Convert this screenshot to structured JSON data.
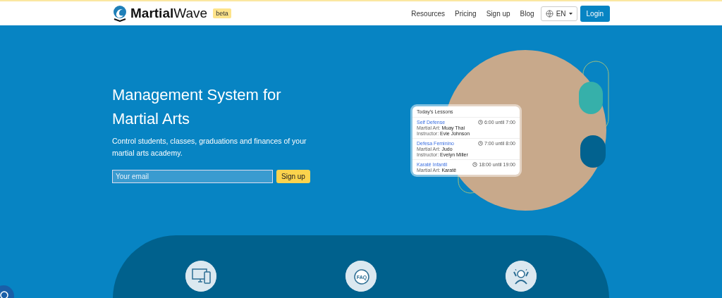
{
  "header": {
    "logo": {
      "bold": "Martial",
      "light": "Wave"
    },
    "badge": "beta",
    "nav": [
      "Resources",
      "Pricing",
      "Sign up",
      "Blog"
    ],
    "language": "EN",
    "login": "Login"
  },
  "hero": {
    "title": "Management System for Martial Arts",
    "subtitle": "Control students, classes, graduations and finances of your martial arts academy.",
    "email": {
      "placeholder": "Your email"
    },
    "signup": "Sign up"
  },
  "lessons_card": {
    "title": "Today's Lessons",
    "lessons": [
      {
        "name": "Self Defense",
        "time": "6:00 until 7:00",
        "details": [
          {
            "label": "Martial Art:",
            "value": "Muay Thai"
          },
          {
            "label": "Instructor:",
            "value": "Evie Johnson"
          }
        ]
      },
      {
        "name": "Defesa Feminino",
        "time": "7:00 until 8:00",
        "details": [
          {
            "label": "Martial Art:",
            "value": "Judo"
          },
          {
            "label": "Instructor:",
            "value": "Evelyn Miller"
          }
        ]
      },
      {
        "name": "Karatê Infantil",
        "time": "18:00 until 19:00",
        "details": [
          {
            "label": "Martial Art:",
            "value": "Karatê"
          }
        ]
      }
    ]
  },
  "features": [
    {
      "kind": "devices"
    },
    {
      "kind": "faq",
      "icon_text": "FAQ"
    },
    {
      "kind": "celebrate"
    }
  ]
}
